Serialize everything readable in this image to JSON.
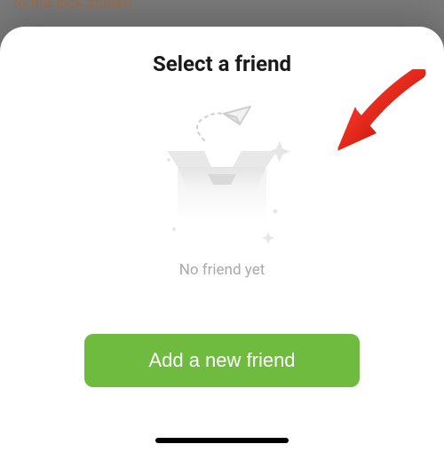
{
  "background": {
    "partial_text": "to the lock screen"
  },
  "sheet": {
    "title": "Select a friend",
    "empty_state": {
      "caption": "No friend yet",
      "icon_name": "empty-inbox-icon"
    },
    "cta_label": "Add a new friend"
  },
  "annotation": {
    "type": "arrow",
    "color": "#e6231e"
  }
}
